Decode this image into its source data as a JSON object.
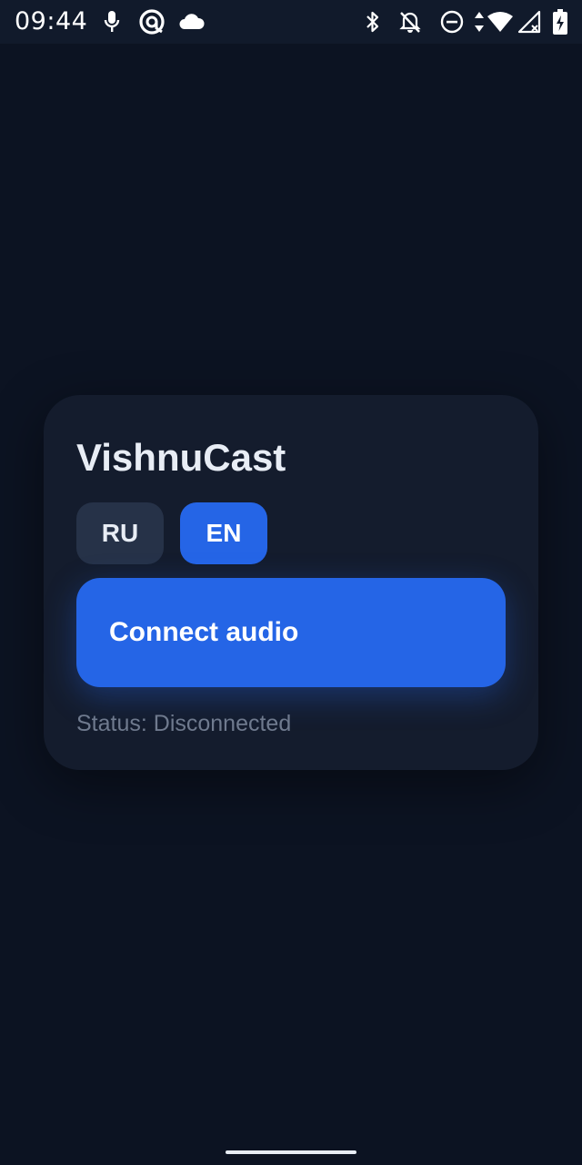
{
  "status_bar": {
    "time": "09:44",
    "icons_left": [
      "microphone-icon",
      "at-sign-icon",
      "cloud-icon"
    ],
    "icons_right": [
      "bluetooth-icon",
      "bell-off-icon",
      "do-not-disturb-icon",
      "data-arrows-icon",
      "wifi-icon",
      "signal-icon",
      "battery-charging-icon"
    ]
  },
  "app": {
    "title": "VishnuCast",
    "languages": [
      {
        "code": "RU",
        "label": "RU",
        "selected": false
      },
      {
        "code": "EN",
        "label": "EN",
        "selected": true
      }
    ],
    "connect_label": "Connect audio",
    "status": "Status: Disconnected"
  },
  "colors": {
    "background": "#0c1322",
    "card": "#141c2d",
    "accent": "#2565e6",
    "button_inactive": "#263248",
    "text": "#e8edf5",
    "muted_text": "#6f7a8e"
  }
}
